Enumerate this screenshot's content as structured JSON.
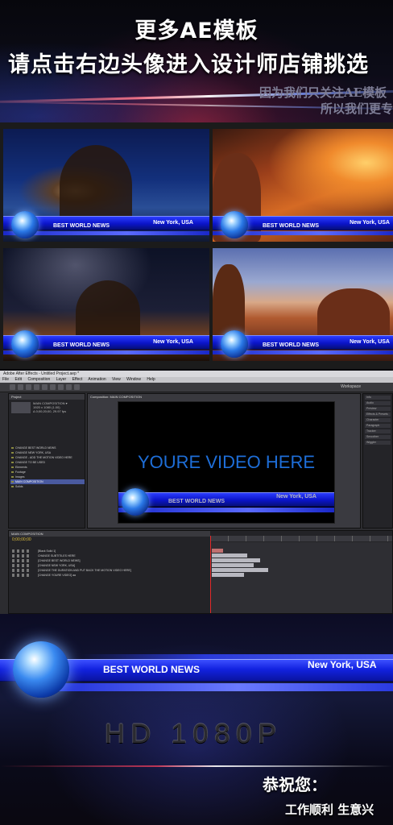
{
  "header": {
    "title_line1": "更多AE模板",
    "title_line2": "请点击右边头像进入设计师店铺挑选",
    "subtitle_line1": "因为我们只关注AE模板",
    "subtitle_line2": "所以我们更专"
  },
  "lower_third": {
    "left_text": "BEST WORLD NEWS",
    "right_text": "New York, USA"
  },
  "ae": {
    "window_title": "Adobe After Effects - Untitled Project.aep *",
    "menu": [
      "File",
      "Edit",
      "Composition",
      "Layer",
      "Effect",
      "Animation",
      "View",
      "Window",
      "Help"
    ],
    "workspace": "Workspace",
    "project_tab": "Project",
    "project_meta": [
      "MAIN COMPOSITION ▾",
      "1920 x 1080 (1.00)",
      "Δ 0;00;20;00, 29.97 fps"
    ],
    "project_items": [
      "CHANGE BEST WORLD NEWS",
      "CHANGE NEW YORK, USA",
      "CHANGE - ADD THE MOTION VIDEO HERE",
      "CHANGE TO BE USED",
      "Elements",
      "Footage",
      "Images",
      "MAIN COMPOSITION",
      "Solids"
    ],
    "comp_tab": "Composition: MAIN COMPOSITION",
    "comp_placeholder": "YOURE VIDEO HERE",
    "right_panel": [
      "Info",
      "Audio",
      "Preview",
      "Effects & Presets",
      "Character",
      "Paragraph",
      "Tracker",
      "Smoother",
      "Wiggler"
    ],
    "timeline_tab": "MAIN COMPOSITION",
    "timecode": "0;00;00;00",
    "layers": [
      "[Black Solid 1]",
      "CHANGE SUBTITILES HERE",
      "[CHANGE BEST WORLD NEWS]",
      "[CHANGE NEW YORK, USA]",
      "[CHANGE THE DURATION AND PUT BACK THE MOTION VIDEO HERE]",
      "[CHANGE YOURE VIDEO] aa"
    ]
  },
  "footer": {
    "hd_label": "HD 1080P",
    "congrats": "恭祝您：",
    "wish": "工作顺利 生意兴"
  }
}
